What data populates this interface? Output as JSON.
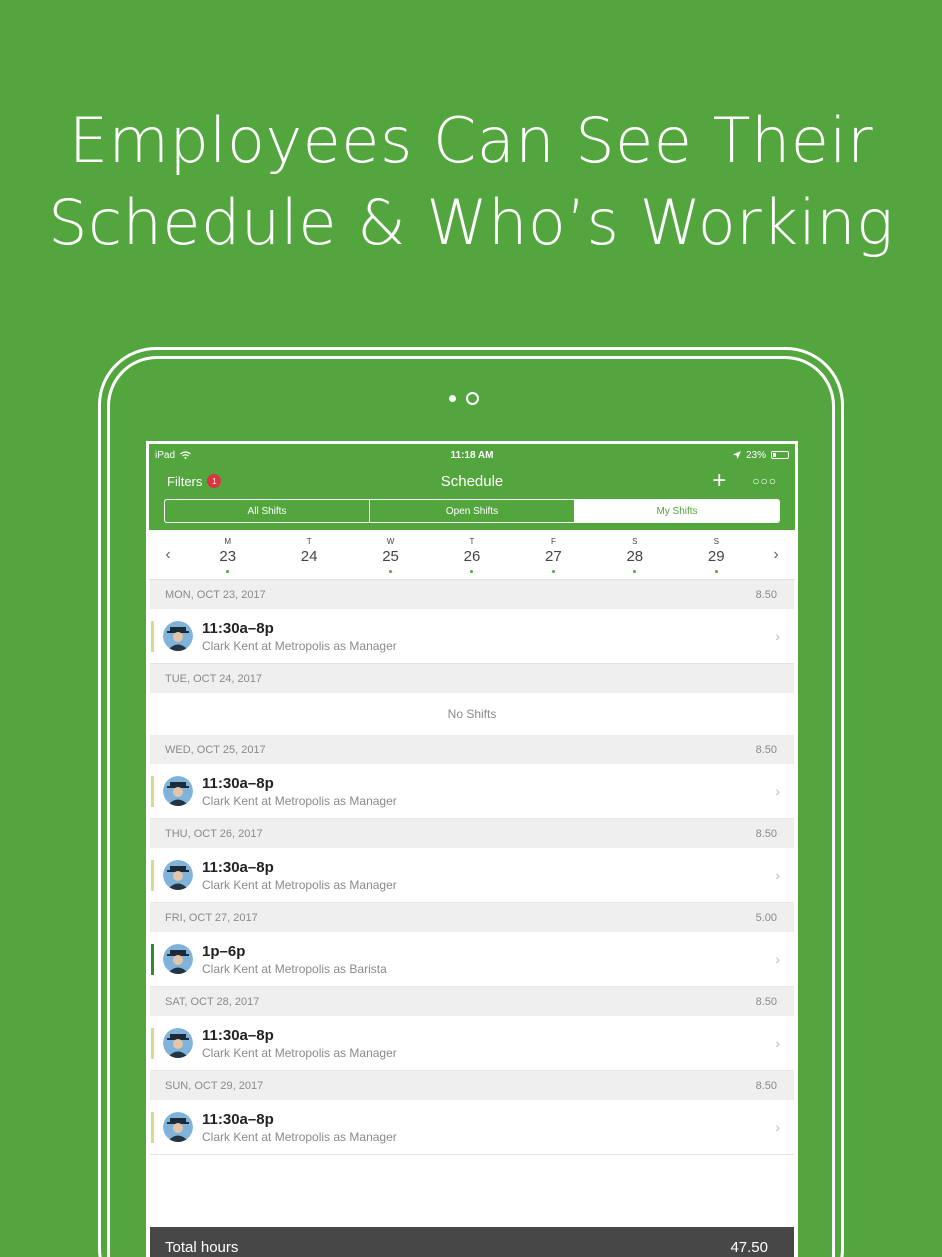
{
  "headline": {
    "line1": "Employees Can See Their",
    "line2": "Schedule & Who’s Working"
  },
  "statusbar": {
    "device": "iPad",
    "time": "11:18 AM",
    "battery": "23%"
  },
  "navbar": {
    "filters_label": "Filters",
    "filters_badge": "1",
    "title": "Schedule"
  },
  "segments": [
    "All Shifts",
    "Open Shifts",
    "My Shifts"
  ],
  "week": {
    "days": [
      {
        "letter": "M",
        "num": "23"
      },
      {
        "letter": "T",
        "num": "24"
      },
      {
        "letter": "W",
        "num": "25"
      },
      {
        "letter": "T",
        "num": "26"
      },
      {
        "letter": "F",
        "num": "27"
      },
      {
        "letter": "S",
        "num": "28"
      },
      {
        "letter": "S",
        "num": "29"
      }
    ]
  },
  "schedule": [
    {
      "date": "MON, OCT 23, 2017",
      "hours": "8.50",
      "time": "11:30a–8p",
      "detail": "Clark Kent at Metropolis as Manager"
    },
    {
      "date": "TUE, OCT 24, 2017",
      "hours": "",
      "empty": "No Shifts"
    },
    {
      "date": "WED, OCT 25, 2017",
      "hours": "8.50",
      "time": "11:30a–8p",
      "detail": "Clark Kent at Metropolis as Manager"
    },
    {
      "date": "THU, OCT 26, 2017",
      "hours": "8.50",
      "time": "11:30a–8p",
      "detail": "Clark Kent at Metropolis as Manager"
    },
    {
      "date": "FRI, OCT 27, 2017",
      "hours": "5.00",
      "time": "1p–6p",
      "detail": "Clark Kent at Metropolis as Barista"
    },
    {
      "date": "SAT, OCT 28, 2017",
      "hours": "8.50",
      "time": "11:30a–8p",
      "detail": "Clark Kent at Metropolis as Manager"
    },
    {
      "date": "SUN, OCT 29, 2017",
      "hours": "8.50",
      "time": "11:30a–8p",
      "detail": "Clark Kent at Metropolis as Manager"
    }
  ],
  "footer": {
    "label": "Total hours",
    "value": "47.50"
  },
  "colors": {
    "brand_green": "#53a63e",
    "manager_bar": "#d5dc8c",
    "barista_bar": "#2f8b2f",
    "badge_red": "#d9363e"
  }
}
